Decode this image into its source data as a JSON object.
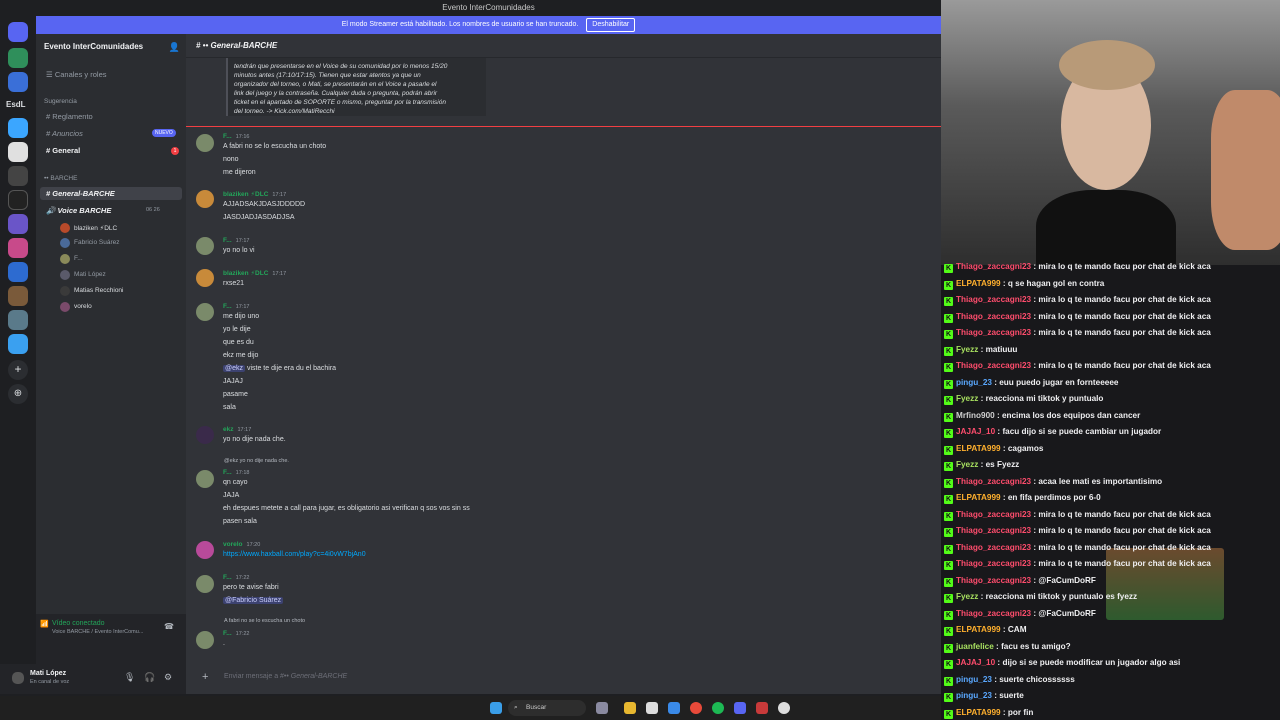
{
  "window": {
    "title": "Evento InterComunidades",
    "banner_text": "El modo Streamer está habilitado. Los nombres de usuario se han truncado.",
    "banner_button": "Deshabilitar"
  },
  "rail": {
    "label_esdl": "EsdL"
  },
  "sidebar": {
    "guild_name": "Evento InterComunidades",
    "roles": "Canales y roles",
    "category1": "Sugerencia",
    "channels": [
      {
        "label": "Reglamento"
      },
      {
        "label": "Anuncios",
        "badge": "NUEVO"
      },
      {
        "label": "General",
        "badge": "1"
      }
    ],
    "category2": "BARCHE",
    "text_channel": "General-BARCHE",
    "voice_channel": "Voice BARCHE",
    "voice_counts": "06  26",
    "voice_users": [
      {
        "name": "blaziken",
        "tag": "DLC"
      },
      {
        "name": "Fabricio Suárez"
      },
      {
        "name": "F..."
      },
      {
        "name": "Mati López"
      },
      {
        "name": "Matias Recchioni"
      },
      {
        "name": "vorelo"
      }
    ],
    "voice_status": "Vídeo conectado",
    "voice_sub": "Voice BARCHE / Evento InterComu...",
    "user_name": "Mati López",
    "user_status": "En canal de voz"
  },
  "chat": {
    "channel_title": "General-BARCHE",
    "embed_lines": [
      "tendrán que presentarse en el Voice de su comunidad por lo menos 15/20",
      "minutos antes (17:10/17:15). Tienen que estar atentos ya que un",
      "organizador del torneo, o Mati, se presentarán en el Voice a pasarle el",
      "link del juego y la contraseña. Cualquier duda o pregunta, podrán abrir",
      "ticket en el apartado de SOPORTE o mismo, preguntar por la transmisión",
      "del torneo. -> Kick.com/MatiRecchi"
    ],
    "messages": [
      {
        "author": "F...",
        "time": "17:16",
        "lines": [
          "A fabri no se lo escucha un choto",
          "nono",
          "me dijeron"
        ]
      },
      {
        "author": "blaziken",
        "tag": "DLC",
        "time": "17:17",
        "lines": [
          "AJJADSAKJDASJDDDDD",
          "JASDJADJASDADJSA"
        ]
      },
      {
        "author": "F...",
        "time": "17:17",
        "lines": [
          "yo no lo vi"
        ]
      },
      {
        "author": "blaziken",
        "tag": "DLC",
        "time": "17:17",
        "lines": [
          "rxse21"
        ]
      },
      {
        "author": "F...",
        "time": "17:17",
        "lines": [
          "me dijo uno",
          "yo le dije",
          "que es du",
          "ekz me dijo",
          "viste te dije era du el bachira",
          "JAJAJ",
          "pasame",
          "sala"
        ],
        "mention": "@ekz"
      },
      {
        "author": "ekz",
        "time": "17:17",
        "lines": [
          "yo no dije nada che."
        ]
      },
      {
        "author": "F...",
        "time": "17:18",
        "reply": "@ekz yo no dije nada che.",
        "lines": [
          "qn cayo",
          "JAJA",
          "eh despues metete a call para jugar, es obligatorio asi verifican q sos vos sin ss",
          "pasen sala"
        ]
      },
      {
        "author": "vorelo",
        "time": "17:20",
        "lines": [
          "https://www.haxball.com/play?c=4i0vW7bjAn0"
        ]
      },
      {
        "author": "F...",
        "time": "17:22",
        "lines": [
          "pero te avise fabri",
          "@Fabricio Suárez"
        ]
      },
      {
        "author": "F...",
        "time": "17:22",
        "reply": "A fabri no se lo escucha un choto",
        "lines": [
          "."
        ]
      }
    ],
    "input_placeholder": "Enviar mensaje a #",
    "input_channel": "General-BARCHE"
  },
  "taskbar": {
    "search": "Buscar"
  },
  "kick_chat": [
    {
      "user": "Thiago_zaccagni23",
      "color": "#ff4d6d",
      "text": "mira lo q te mando facu por chat de kick aca"
    },
    {
      "user": "ELPATA999",
      "color": "#ffb02e",
      "text": "q se hagan gol en contra"
    },
    {
      "user": "Thiago_zaccagni23",
      "color": "#ff4d6d",
      "text": "mira lo q te mando facu por chat de kick aca"
    },
    {
      "user": "Thiago_zaccagni23",
      "color": "#ff4d6d",
      "text": "mira lo q te mando facu por chat de kick aca"
    },
    {
      "user": "Thiago_zaccagni23",
      "color": "#ff4d6d",
      "text": "mira lo q te mando facu por chat de kick aca"
    },
    {
      "user": "Fyezz",
      "color": "#a8e060",
      "text": "matiuuu"
    },
    {
      "user": "Thiago_zaccagni23",
      "color": "#ff4d6d",
      "text": "mira lo q te mando facu por chat de kick aca"
    },
    {
      "user": "pingu_23",
      "color": "#5aa8ff",
      "text": "euu puedo jugar en fornteeeee"
    },
    {
      "user": "Fyezz",
      "color": "#a8e060",
      "text": "reacciona mi tiktok y puntualo"
    },
    {
      "user": "Mrfino900",
      "color": "#d0d0d0",
      "text": "encima los dos equipos dan cancer"
    },
    {
      "user": "JAJAJ_10",
      "color": "#ff4d6d",
      "text": "facu dijo si se puede cambiar un jugador"
    },
    {
      "user": "ELPATA999",
      "color": "#ffb02e",
      "text": "cagamos"
    },
    {
      "user": "Fyezz",
      "color": "#a8e060",
      "text": "es Fyezz"
    },
    {
      "user": "Thiago_zaccagni23",
      "color": "#ff4d6d",
      "text": "acaa lee mati es importantisimo"
    },
    {
      "user": "ELPATA999",
      "color": "#ffb02e",
      "text": "en fifa perdimos por 6-0"
    },
    {
      "user": "Thiago_zaccagni23",
      "color": "#ff4d6d",
      "text": "mira lo q te mando facu por chat de kick aca"
    },
    {
      "user": "Thiago_zaccagni23",
      "color": "#ff4d6d",
      "text": "mira lo q te mando facu por chat de kick aca"
    },
    {
      "user": "Thiago_zaccagni23",
      "color": "#ff4d6d",
      "text": "mira lo q te mando facu por chat de kick aca"
    },
    {
      "user": "Thiago_zaccagni23",
      "color": "#ff4d6d",
      "text": "mira lo q te mando facu por chat de kick aca"
    },
    {
      "user": "Thiago_zaccagni23",
      "color": "#ff4d6d",
      "text": "@FaCumDoRF"
    },
    {
      "user": "Fyezz",
      "color": "#a8e060",
      "text": "reacciona mi tiktok y puntualo es fyezz"
    },
    {
      "user": "Thiago_zaccagni23",
      "color": "#ff4d6d",
      "text": "@FaCumDoRF"
    },
    {
      "user": "ELPATA999",
      "color": "#ffb02e",
      "text": "CAM"
    },
    {
      "user": "juanfelice",
      "color": "#a8e060",
      "text": "facu es tu amigo?"
    },
    {
      "user": "JAJAJ_10",
      "color": "#ff4d6d",
      "text": "dijo si se puede modificar un jugador algo asi"
    },
    {
      "user": "pingu_23",
      "color": "#5aa8ff",
      "text": "suerte chicossssss"
    },
    {
      "user": "pingu_23",
      "color": "#5aa8ff",
      "text": "suerte"
    },
    {
      "user": "ELPATA999",
      "color": "#ffb02e",
      "text": "por fin"
    }
  ]
}
